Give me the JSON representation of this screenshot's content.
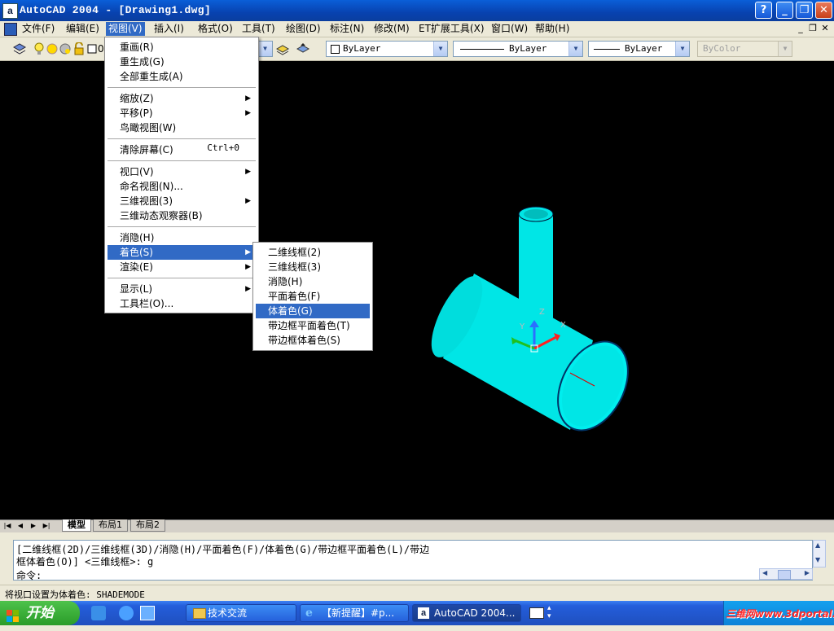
{
  "window": {
    "title": "AutoCAD 2004 - [Drawing1.dwg]",
    "app_icon": "a"
  },
  "menubar": [
    "文件(F)",
    "编辑(E)",
    "视图(V)",
    "插入(I)",
    "格式(O)",
    "工具(T)",
    "绘图(D)",
    "标注(N)",
    "修改(M)",
    "ET扩展工具(X)",
    "窗口(W)",
    "帮助(H)"
  ],
  "toolbar": {
    "layer_value": "0",
    "color_combo": "ByLayer",
    "linetype_combo": "ByLayer",
    "lineweight_combo": "ByLayer",
    "plotstyle_combo": "ByColor"
  },
  "view_menu": {
    "groups": [
      [
        {
          "label": "重画(R)"
        },
        {
          "label": "重生成(G)"
        },
        {
          "label": "全部重生成(A)"
        }
      ],
      [
        {
          "label": "缩放(Z)",
          "submenu": true
        },
        {
          "label": "平移(P)",
          "submenu": true
        },
        {
          "label": "鸟瞰视图(W)"
        }
      ],
      [
        {
          "label": "清除屏幕(C)",
          "shortcut": "Ctrl+0"
        }
      ],
      [
        {
          "label": "视口(V)",
          "submenu": true
        },
        {
          "label": "命名视图(N)..."
        },
        {
          "label": "三维视图(3)",
          "submenu": true
        },
        {
          "label": "三维动态观察器(B)"
        }
      ],
      [
        {
          "label": "消隐(H)"
        },
        {
          "label": "着色(S)",
          "submenu": true,
          "highlighted": true
        },
        {
          "label": "渲染(E)",
          "submenu": true
        }
      ],
      [
        {
          "label": "显示(L)",
          "submenu": true
        },
        {
          "label": "工具栏(O)..."
        }
      ]
    ]
  },
  "shade_submenu": [
    {
      "label": "二维线框(2)"
    },
    {
      "label": "三维线框(3)"
    },
    {
      "label": "消隐(H)"
    },
    {
      "label": "平面着色(F)"
    },
    {
      "label": "体着色(G)",
      "highlighted": true
    },
    {
      "label": "带边框平面着色(T)"
    },
    {
      "label": "带边框体着色(S)"
    }
  ],
  "ucs": {
    "x": "X",
    "y": "Y",
    "z": "Z"
  },
  "tabs": [
    "模型",
    "布局1",
    "布局2"
  ],
  "command": {
    "line1": "[二维线框(2D)/三维线框(3D)/消隐(H)/平面着色(F)/体着色(G)/带边框平面着色(L)/带边",
    "line2": "框体着色(O)] <三维线框>: g",
    "prompt": "命令:"
  },
  "status": {
    "text": "将视口设置为体着色:  SHADEMODE"
  },
  "taskbar": {
    "start": "开始",
    "tasks": [
      "技术交流",
      "【新提醒】#p...",
      "AutoCAD 2004..."
    ],
    "watermark": "三维网www.3dportal.cn"
  },
  "colors": {
    "accent": "#316ac5",
    "model": "#00e5e5",
    "canvas": "#000000"
  }
}
